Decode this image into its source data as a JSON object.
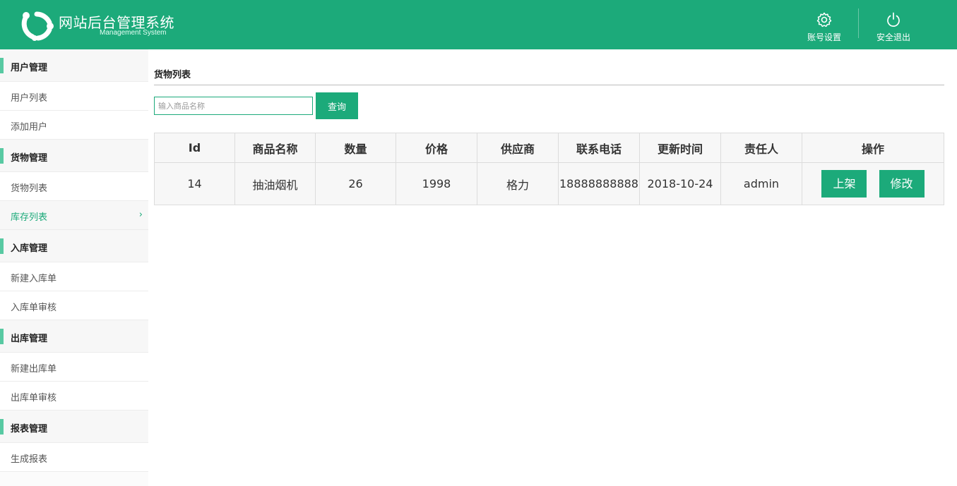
{
  "header": {
    "title": "网站后台管理系统",
    "subtitle": "Management System",
    "account_label": "账号设置",
    "logout_label": "安全退出",
    "accent_color": "#1caa7a"
  },
  "sidebar": {
    "groups": [
      {
        "label": "用户管理",
        "items": [
          {
            "label": "用户列表"
          },
          {
            "label": "添加用户"
          }
        ]
      },
      {
        "label": "货物管理",
        "items": [
          {
            "label": "货物列表"
          },
          {
            "label": "库存列表",
            "active": true
          }
        ]
      },
      {
        "label": "入库管理",
        "items": [
          {
            "label": "新建入库单"
          },
          {
            "label": "入库单审核"
          }
        ]
      },
      {
        "label": "出库管理",
        "items": [
          {
            "label": "新建出库单"
          },
          {
            "label": "出库单审核"
          }
        ]
      },
      {
        "label": "报表管理",
        "items": [
          {
            "label": "生成报表"
          }
        ]
      }
    ]
  },
  "main": {
    "section_title": "货物列表",
    "search": {
      "placeholder": "输入商品名称",
      "value": "",
      "button_label": "查询"
    },
    "table": {
      "headers": [
        "Id",
        "商品名称",
        "数量",
        "价格",
        "供应商",
        "联系电话",
        "更新时间",
        "责任人",
        "操作"
      ],
      "rows": [
        {
          "id": "14",
          "name": "抽油烟机",
          "quantity": "26",
          "price": "1998",
          "supplier": "格力",
          "phone": "18888888888",
          "updated": "2018-10-24",
          "owner": "admin",
          "actions": [
            "上架",
            "修改"
          ]
        }
      ]
    }
  }
}
